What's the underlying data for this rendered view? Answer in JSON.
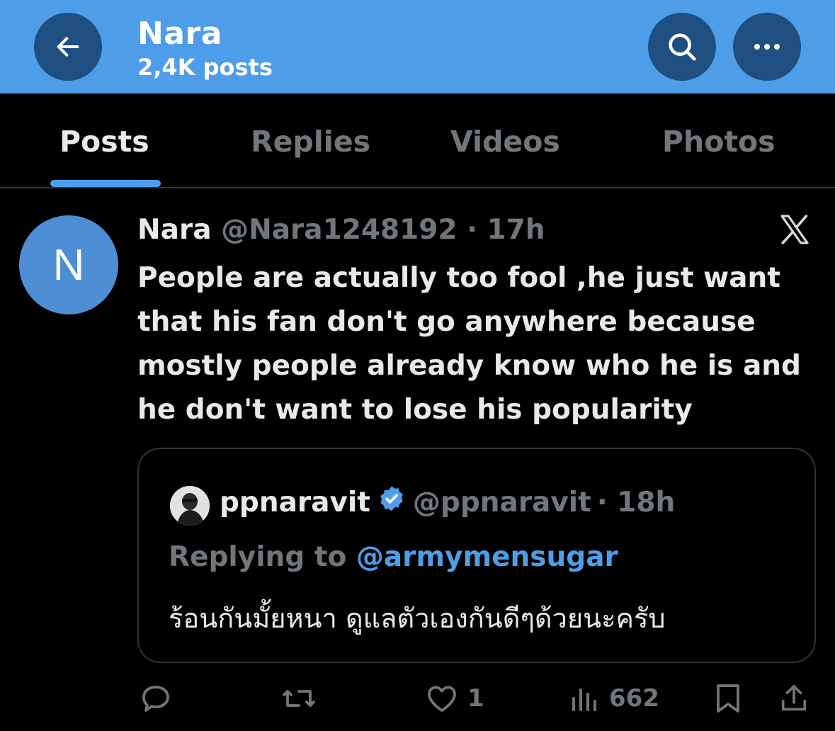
{
  "header": {
    "title": "Nara",
    "subtitle": "2,4K posts"
  },
  "icons": {
    "back": "arrow-left-icon",
    "search": "search-icon",
    "more": "more-icon",
    "platform": "x-logo-icon"
  },
  "tabs": [
    {
      "label": "Posts",
      "active": true
    },
    {
      "label": "Replies",
      "active": false
    },
    {
      "label": "Videos",
      "active": false
    },
    {
      "label": "Photos",
      "active": false
    }
  ],
  "post": {
    "avatar_letter": "N",
    "display_name": "Nara",
    "handle": "@Nara1248192",
    "time": "· 17h",
    "text": "People are actually too fool ,he just want that his fan don't go anywhere because mostly people already know who he is and he don't want to lose his popularity",
    "quote": {
      "display_name": "ppnaravit",
      "handle": "@ppnaravit",
      "time": "· 18h",
      "replying_prefix": "Replying to",
      "replying_to": "@armymensugar",
      "text": "ร้อนกันมั้ยหนา ดูแลตัวเองกันดีๆด้วยนะครับ"
    },
    "actions": {
      "reply_count": "",
      "repost_count": "",
      "like_count": "1",
      "views_count": "662"
    }
  },
  "colors": {
    "accent": "#4e9de8",
    "header_btn": "#1e4f80",
    "muted": "#71767b",
    "text": "#e7e9ea"
  }
}
